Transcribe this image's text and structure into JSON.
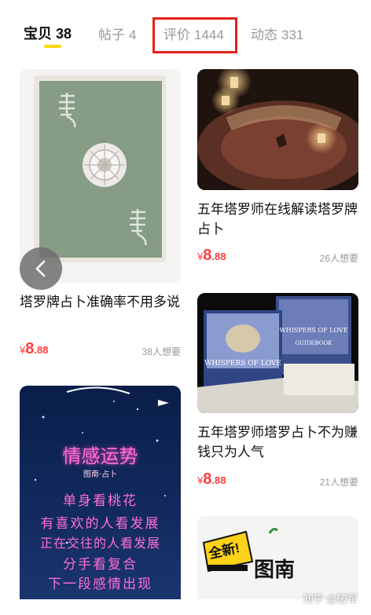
{
  "tabs": [
    {
      "label": "宝贝",
      "count": "38"
    },
    {
      "label": "帖子",
      "count": "4"
    },
    {
      "label": "评价",
      "count": "1444"
    },
    {
      "label": "动态",
      "count": "331"
    }
  ],
  "items": [
    {
      "title": "塔罗牌占卜准确率不用多说",
      "price_symbol": "¥",
      "price_int": "8",
      "price_dec": ".88",
      "wants": "38人想要"
    },
    {
      "title": "五年塔罗师在线解读塔罗牌占卜",
      "price_symbol": "¥",
      "price_int": "8",
      "price_dec": ".88",
      "wants": "26人想要"
    },
    {
      "title": "五年塔罗师塔罗占卜不为赚钱只为人气",
      "price_symbol": "¥",
      "price_int": "8",
      "price_dec": ".88",
      "wants": "21人想要"
    }
  ],
  "love_card": {
    "title": "情感运势",
    "subtitle": "图南·占卜",
    "lines": [
      "单身看桃花",
      "有喜欢的人看发展",
      "正在交往的人看发展",
      "分手看复合",
      "下一段感情出现"
    ]
  },
  "tarot_box": {
    "card_text": "WHISPERS OF LOVE",
    "box_text": "WHISPERS OF LOVE",
    "guidebook": "GUIDEBOOK"
  },
  "new_card": {
    "badge": "全新!",
    "logo_text": "图南"
  },
  "watermark": "知乎 @破军",
  "colors": {
    "price": "#ff3d3d",
    "tab_underline": "#ffd800",
    "highlight_box": "#e2231a"
  }
}
